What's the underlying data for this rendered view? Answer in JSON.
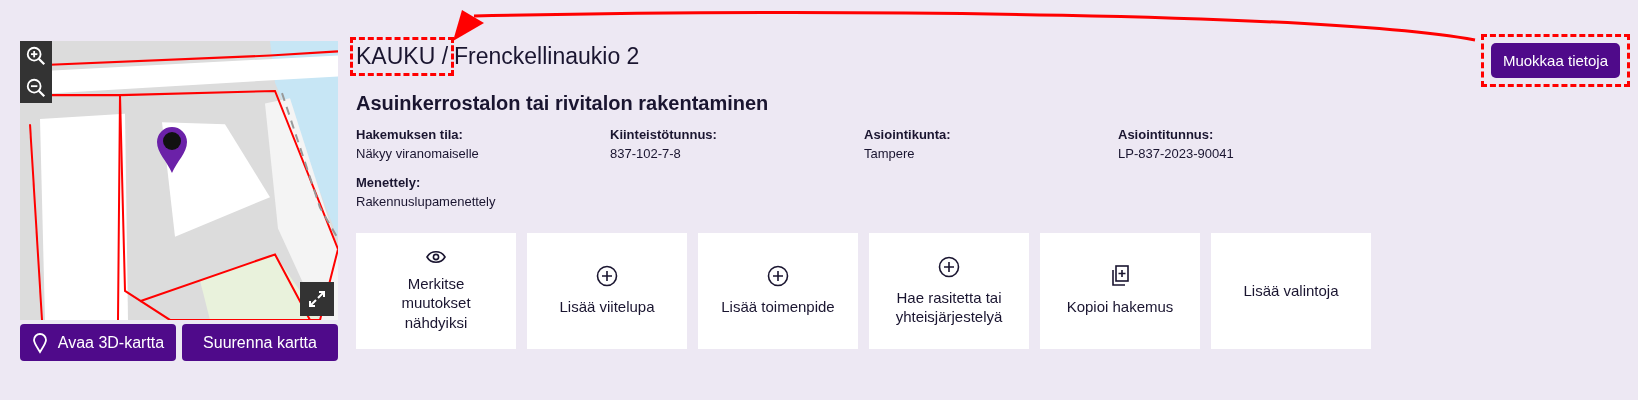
{
  "map": {
    "pin": true,
    "fullscreen": true,
    "buttons": [
      {
        "label": "Avaa 3D-kartta",
        "kind": "pin"
      },
      {
        "label": "Suurenna kartta",
        "kind": "plain"
      }
    ]
  },
  "header": {
    "prefix": "KAUKU /",
    "prefix_highlighted": true,
    "name": "Frenckellinaukio 2"
  },
  "edit_button": {
    "label": "Muokkaa tietoja",
    "highlighted": true
  },
  "annotation_arrow": true,
  "title": "Asuinkerrostalon tai rivitalon rakentaminen",
  "fields": [
    {
      "label": "Hakemuksen tila:",
      "value": "Näkyy viranomaiselle"
    },
    {
      "label": "Kiinteistötunnus:",
      "value": "837-102-7-8"
    },
    {
      "label": "Asiointikunta:",
      "value": "Tampere"
    },
    {
      "label": "Asiointitunnus:",
      "value": "LP-837-2023-90041"
    },
    {
      "label": "Menettely:",
      "value": "Rakennuslupamenettely"
    }
  ],
  "actions": [
    {
      "label": "Merkitse muutokset nähdyiksi",
      "kind": "eye"
    },
    {
      "label": "Lisää viitelupa",
      "kind": "plus"
    },
    {
      "label": "Lisää toimenpide",
      "kind": "plus"
    },
    {
      "label": "Hae rasitetta tai yhteisjärjestelyä",
      "kind": "plus"
    },
    {
      "label": "Kopioi hakemus",
      "kind": "copy"
    },
    {
      "label": "Lisää valintoja",
      "kind": "plain"
    }
  ]
}
